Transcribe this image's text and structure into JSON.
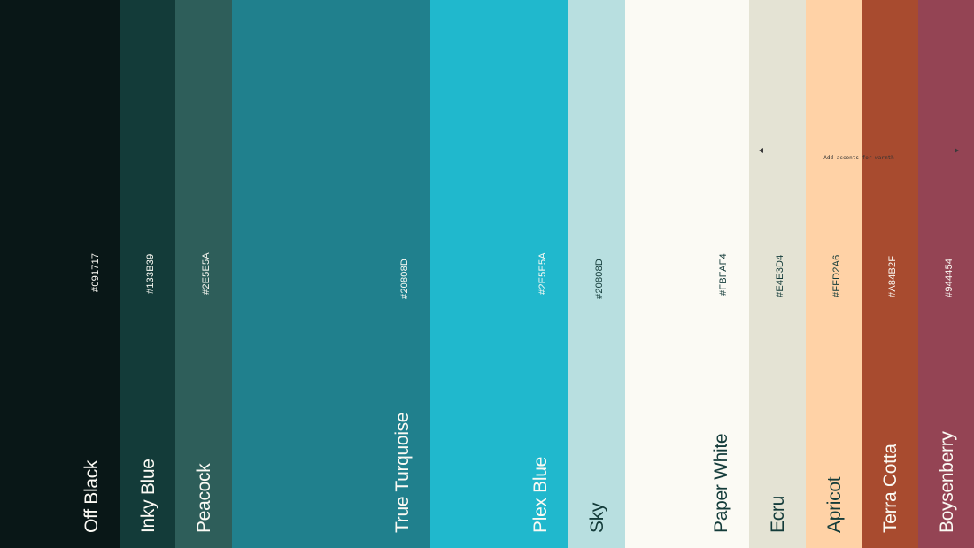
{
  "swatches": [
    {
      "name": "Off Black",
      "hex": "#091717",
      "color": "#091717",
      "text_color": "#FBFAF4"
    },
    {
      "name": "Inky Blue",
      "hex": "#133B39",
      "color": "#133B39",
      "text_color": "#FBFAF4"
    },
    {
      "name": "Peacock",
      "hex": "#2E5E5A",
      "color": "#2E5E5A",
      "text_color": "#FBFAF4"
    },
    {
      "name": "True Turquoise",
      "hex": "#20808D",
      "color": "#20808D",
      "text_color": "#FBFAF4"
    },
    {
      "name": "Plex Blue",
      "hex": "#2E5E5A",
      "color": "#20B8CD",
      "text_color": "#FBFAF4"
    },
    {
      "name": "Sky",
      "hex": "#20808D",
      "color": "#B8DFE0",
      "text_color": "#133B39"
    },
    {
      "name": "Paper White",
      "hex": "#FBFAF4",
      "color": "#FBFAF4",
      "text_color": "#133B39"
    },
    {
      "name": "Ecru",
      "hex": "#E4E3D4",
      "color": "#E4E3D4",
      "text_color": "#133B39"
    },
    {
      "name": "Apricot",
      "hex": "#FFD2A6",
      "color": "#FFD2A6",
      "text_color": "#133B39"
    },
    {
      "name": "Terra Cotta",
      "hex": "#A84B2F",
      "color": "#A84B2F",
      "text_color": "#FBFAF4"
    },
    {
      "name": "Boysenberry",
      "hex": "#944454",
      "color": "#944454",
      "text_color": "#FBFAF4"
    }
  ],
  "annotation": {
    "label": "Add accents for warmth"
  }
}
